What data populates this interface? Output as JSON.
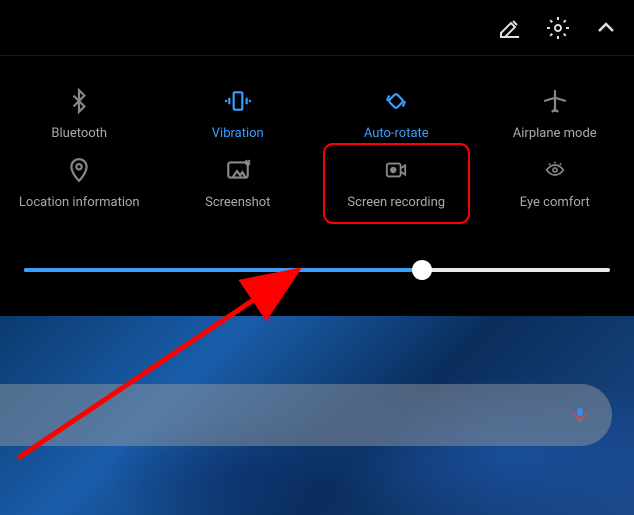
{
  "topbar": {
    "edit_icon": "edit",
    "settings_icon": "settings",
    "expand_icon": "chevron-up"
  },
  "tiles": [
    {
      "id": "bluetooth",
      "label": "Bluetooth",
      "active": false
    },
    {
      "id": "vibration",
      "label": "Vibration",
      "active": true
    },
    {
      "id": "autorotate",
      "label": "Auto-rotate",
      "active": true
    },
    {
      "id": "airplane",
      "label": "Airplane mode",
      "active": false
    },
    {
      "id": "location",
      "label": "Location information",
      "active": false
    },
    {
      "id": "screenshot",
      "label": "Screenshot",
      "active": false
    },
    {
      "id": "screenrecord",
      "label": "Screen recording",
      "active": false,
      "highlighted": true
    },
    {
      "id": "eyecomfort",
      "label": "Eye comfort",
      "active": false
    }
  ],
  "brightness": {
    "value": 68
  },
  "search": {
    "mic": "microphone"
  },
  "annotation": {
    "highlight_color": "#ff0000",
    "arrow_target": "screenrecord"
  }
}
